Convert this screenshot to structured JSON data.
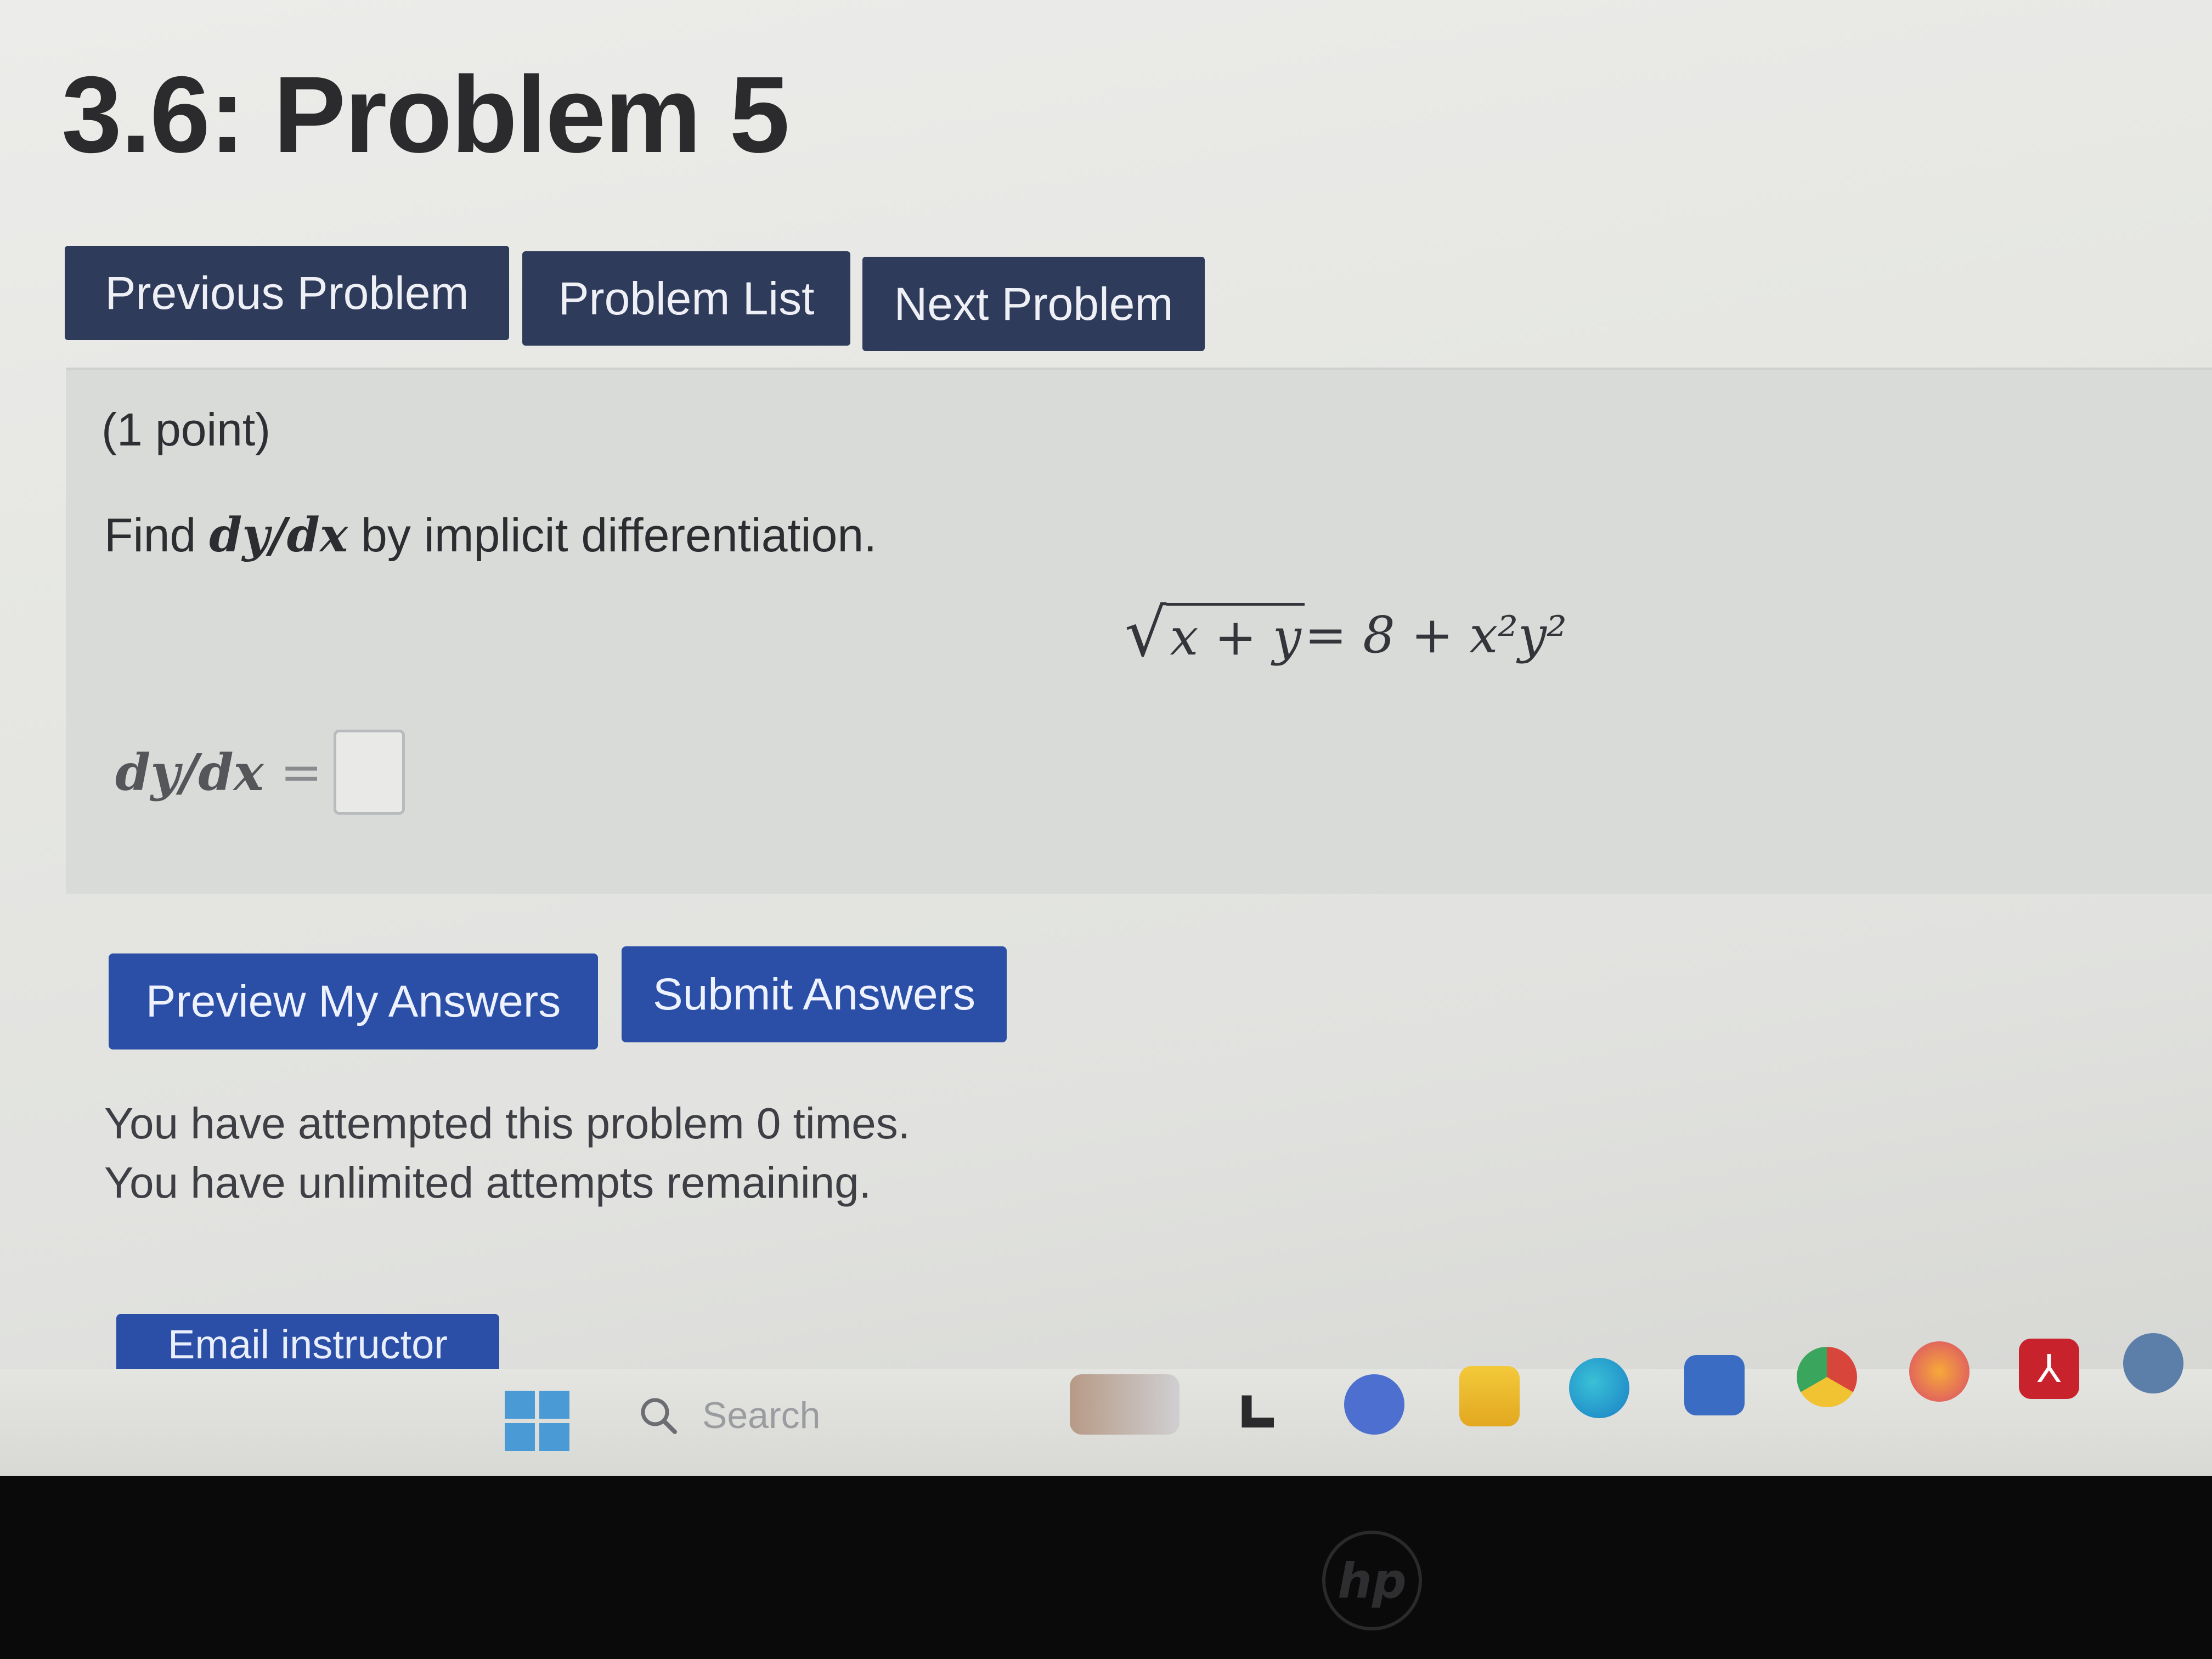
{
  "page": {
    "title": "3.6: Problem 5"
  },
  "nav": {
    "previous_label": "Previous Problem",
    "list_label": "Problem List",
    "next_label": "Next Problem"
  },
  "problem": {
    "points": "(1 point)",
    "instructions_prefix": "Find ",
    "instructions_math": "dy/dx",
    "instructions_suffix": " by implicit differentiation.",
    "equation_radicand": "x + y",
    "equation_rest": " = 8 + x²y²",
    "answer_label": "dy/dx",
    "answer_equals": "=",
    "answer_value": ""
  },
  "actions": {
    "preview_label": "Preview My Answers",
    "submit_label": "Submit Answers"
  },
  "attempts": {
    "line1": "You have attempted this problem 0 times.",
    "line2": "You have unlimited attempts remaining."
  },
  "email": {
    "label": "Email instructor"
  },
  "taskbar": {
    "search_placeholder": "Search",
    "icons": [
      "windows-start-icon",
      "search-icon",
      "widgets-icon",
      "task-view-icon",
      "chat-icon",
      "file-explorer-icon",
      "edge-icon",
      "store-icon",
      "chrome-icon",
      "firefox-icon",
      "acrobat-icon",
      "settings-icon"
    ]
  },
  "bezel": {
    "brand": "hp"
  },
  "colors": {
    "nav_button": "#2f3b5b",
    "action_button": "#2b4fa6"
  }
}
